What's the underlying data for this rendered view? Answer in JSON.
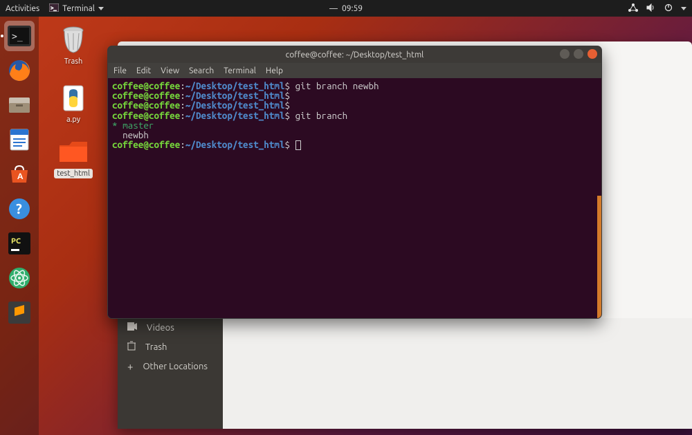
{
  "topbar": {
    "activities": "Activities",
    "app_indicator": "Terminal",
    "clock": "09:59",
    "clock_sep": "—"
  },
  "launcher": [
    {
      "name": "terminal-app-icon",
      "active": true
    },
    {
      "name": "firefox-app-icon",
      "active": false
    },
    {
      "name": "files-app-icon",
      "active": false
    },
    {
      "name": "writer-app-icon",
      "active": false
    },
    {
      "name": "software-center-app-icon",
      "active": false
    },
    {
      "name": "help-app-icon",
      "active": false
    },
    {
      "name": "pycharm-app-icon",
      "active": false
    },
    {
      "name": "atom-app-icon",
      "active": false
    },
    {
      "name": "sublime-app-icon",
      "active": false
    }
  ],
  "desktop": {
    "trash": "Trash",
    "apy": "a.py",
    "test_html": "test_html"
  },
  "files_sidebar": {
    "videos": "Videos",
    "trash": "Trash",
    "other": "Other Locations"
  },
  "terminal": {
    "title": "coffee@coffee: ~/Desktop/test_html",
    "menus": {
      "file": "File",
      "edit": "Edit",
      "view": "View",
      "search": "Search",
      "terminal": "Terminal",
      "help": "Help"
    },
    "prompt_user": "coffee@coffee",
    "prompt_sep": ":",
    "prompt_path": "~/Desktop/test_html",
    "prompt_end": "$",
    "lines": {
      "cmd1": " git branch newbh",
      "cmd_blank": "",
      "cmd2": " git branch",
      "out_active_marker": "* ",
      "out_active_branch": "master",
      "out_branch2": "  newbh"
    }
  }
}
